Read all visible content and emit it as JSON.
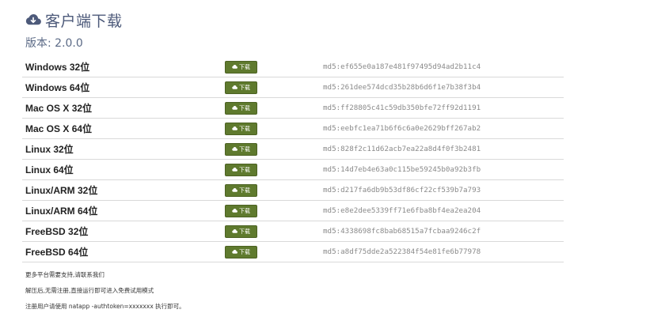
{
  "header": {
    "title": "客户端下载",
    "icon": "cloud-download-icon"
  },
  "version": "版本: 2.0.0",
  "download_label": "下载",
  "downloads": [
    {
      "os": "Windows 32位",
      "md5": "md5:ef655e0a187e481f97495d94ad2b11c4"
    },
    {
      "os": "Windows 64位",
      "md5": "md5:261dee574dcd35b28b6d6f1e7b38f3b4"
    },
    {
      "os": "Mac OS X 32位",
      "md5": "md5:ff28805c41c59db350bfe72ff92d1191"
    },
    {
      "os": "Mac OS X 64位",
      "md5": "md5:eebfc1ea71b6f6c6a0e2629bff267ab2"
    },
    {
      "os": "Linux 32位",
      "md5": "md5:828f2c11d62acb7ea22a8d4f0f3b2481"
    },
    {
      "os": "Linux 64位",
      "md5": "md5:14d7eb4e63a0c115be59245b0a92b3fb"
    },
    {
      "os": "Linux/ARM 32位",
      "md5": "md5:d217fa6db9b53df86cf22cf539b7a793"
    },
    {
      "os": "Linux/ARM 64位",
      "md5": "md5:e8e2dee5339ff71e6fba8bf4ea2ea204"
    },
    {
      "os": "FreeBSD 32位",
      "md5": "md5:4338698fc8bab68515a7fcbaa9246c2f"
    },
    {
      "os": "FreeBSD 64位",
      "md5": "md5:a8df75dde2a522384f54e81fe6b77978"
    }
  ],
  "notes": [
    "更多平台需要支持,请联系我们",
    "解压后,无需注册,直接运行即可进入免费试用模式",
    "注册用户请使用 natapp -authtoken=xxxxxxx 执行即可。"
  ],
  "colors": {
    "button_bg": "#5f7a2e",
    "title": "#4d5a7a"
  }
}
